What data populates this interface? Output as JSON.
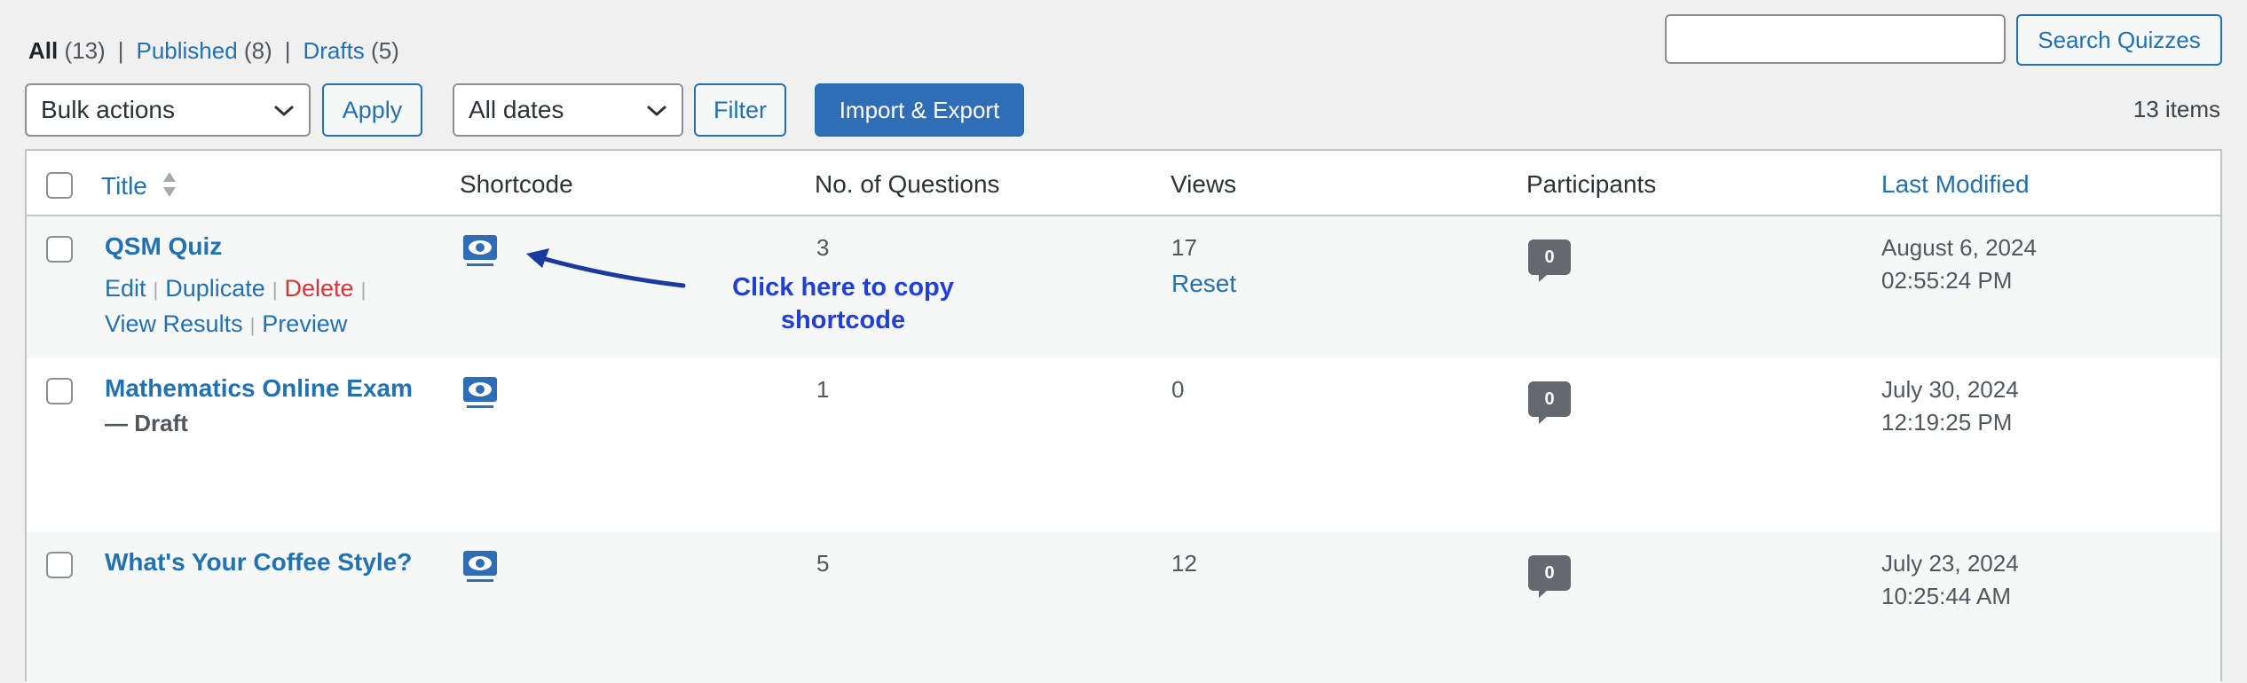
{
  "filters": {
    "all_label": "All",
    "all_count": "(13)",
    "published_label": "Published",
    "published_count": "(8)",
    "drafts_label": "Drafts",
    "drafts_count": "(5)",
    "separator": "|"
  },
  "search": {
    "value": "",
    "button_label": "Search Quizzes"
  },
  "toolbar": {
    "bulk_actions_selected": "Bulk actions",
    "apply_label": "Apply",
    "dates_selected": "All dates",
    "filter_label": "Filter",
    "import_export_label": "Import & Export",
    "items_count": "13 items"
  },
  "columns": {
    "title": "Title",
    "shortcode": "Shortcode",
    "questions": "No. of Questions",
    "views": "Views",
    "participants": "Participants",
    "last_modified": "Last Modified"
  },
  "row_actions": {
    "edit": "Edit",
    "duplicate": "Duplicate",
    "delete": "Delete",
    "view_results": "View Results",
    "preview": "Preview",
    "separator": "|",
    "reset": "Reset"
  },
  "rows": [
    {
      "title": "QSM Quiz",
      "state": "",
      "questions": "3",
      "views": "17",
      "participants": "0",
      "modified_date": "August 6, 2024",
      "modified_time": "02:55:24 PM"
    },
    {
      "title": "Mathematics Online Exam",
      "state": "— Draft",
      "questions": "1",
      "views": "0",
      "participants": "0",
      "modified_date": "July 30, 2024",
      "modified_time": "12:19:25 PM"
    },
    {
      "title": "What's Your Coffee Style?",
      "state": "",
      "questions": "5",
      "views": "12",
      "participants": "0",
      "modified_date": "July 23, 2024",
      "modified_time": "10:25:44 AM"
    }
  ],
  "annotation": {
    "line1": "Click here to copy",
    "line2": "shortcode"
  },
  "icons": {
    "shortcode": "eye-screen-icon",
    "sort": "sort-arrows-icon",
    "select_chevron": "chevron-down-icon",
    "participants": "comment-bubble-icon"
  },
  "colors": {
    "link": "#2271b1",
    "primary_button": "#2f6eb6",
    "delete": "#d63638",
    "annotation": "#1f3fd8",
    "bubble": "#646970"
  }
}
